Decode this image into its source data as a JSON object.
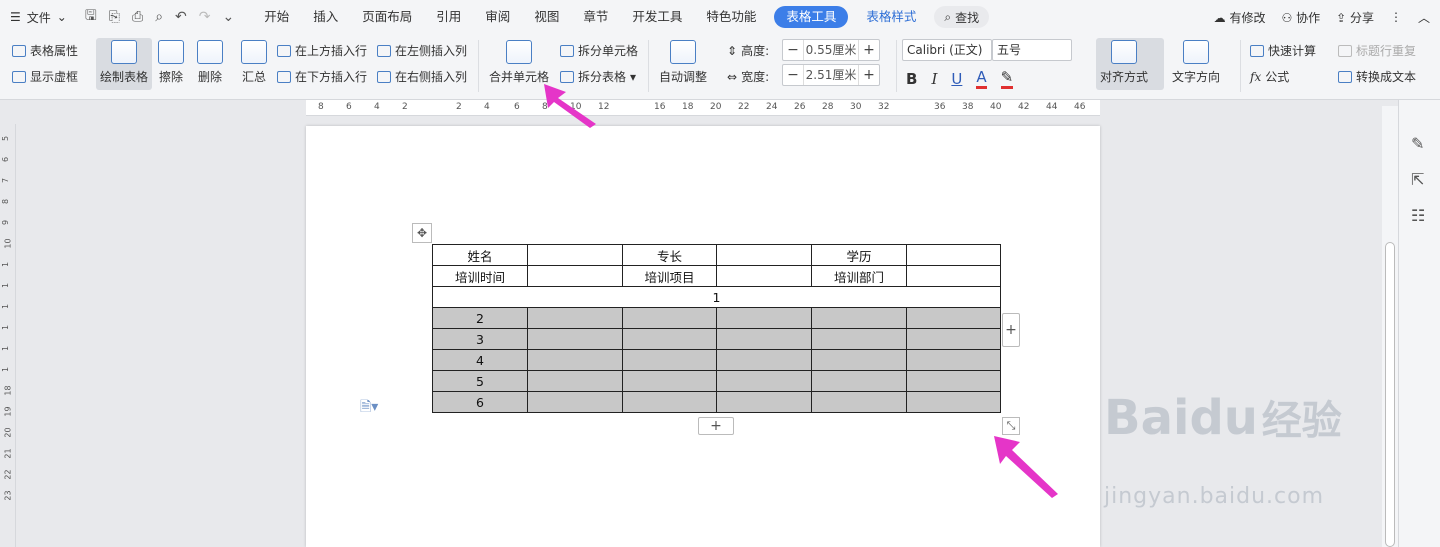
{
  "menubar": {
    "file": "文件",
    "tabs": [
      "开始",
      "插入",
      "页面布局",
      "引用",
      "审阅",
      "视图",
      "章节",
      "开发工具",
      "特色功能",
      "表格工具",
      "表格样式"
    ],
    "search": "查找",
    "right": {
      "changes": "有修改",
      "collab": "协作",
      "share": "分享"
    }
  },
  "ribbon": {
    "table_props": "表格属性",
    "show_grid": "显示虚框",
    "draw_table": "绘制表格",
    "erase": "擦除",
    "delete": "删除",
    "summary": "汇总",
    "insert_above": "在上方插入行",
    "insert_below": "在下方插入行",
    "insert_left": "在左侧插入列",
    "insert_right": "在右侧插入列",
    "merge": "合并单元格",
    "split_cell": "拆分单元格",
    "split_table": "拆分表格",
    "auto_fit": "自动调整",
    "height_label": "高度:",
    "height_value": "0.55厘米",
    "width_label": "宽度:",
    "width_value": "2.51厘米",
    "font": "Calibri (正文)",
    "size": "五号",
    "align": "对齐方式",
    "text_dir": "文字方向",
    "quick_calc": "快速计算",
    "title_repeat": "标题行重复",
    "formula": "公式",
    "to_text": "转换成文本"
  },
  "ruler": [
    "8",
    "6",
    "4",
    "2",
    "2",
    "4",
    "6",
    "8",
    "10",
    "12",
    "16",
    "18",
    "20",
    "22",
    "24",
    "26",
    "28",
    "30",
    "32",
    "36",
    "38",
    "40",
    "42",
    "44",
    "46"
  ],
  "vruler": [
    "5",
    "6",
    "7",
    "8",
    "9",
    "10",
    "1",
    "1",
    "1",
    "1",
    "1",
    "1",
    "18",
    "19",
    "20",
    "21",
    "22",
    "23"
  ],
  "table": {
    "row1": [
      "姓名",
      "",
      "专长",
      "",
      "学历",
      ""
    ],
    "row2": [
      "培训时间",
      "",
      "培训项目",
      "",
      "培训部门",
      ""
    ],
    "merged": "1",
    "rows": [
      [
        "2",
        "",
        "",
        "",
        "",
        ""
      ],
      [
        "3",
        "",
        "",
        "",
        "",
        ""
      ],
      [
        "4",
        "",
        "",
        "",
        "",
        ""
      ],
      [
        "5",
        "",
        "",
        "",
        "",
        ""
      ],
      [
        "6",
        "",
        "",
        "",
        "",
        ""
      ]
    ]
  },
  "watermark": {
    "logo": "Bai",
    "logo2": "du",
    "cn": "经验",
    "url": "jingyan.baidu.com"
  },
  "colors": {
    "accent": "#3c7ee8",
    "arrow": "#e535c8",
    "shade": "#c8c8c8"
  }
}
